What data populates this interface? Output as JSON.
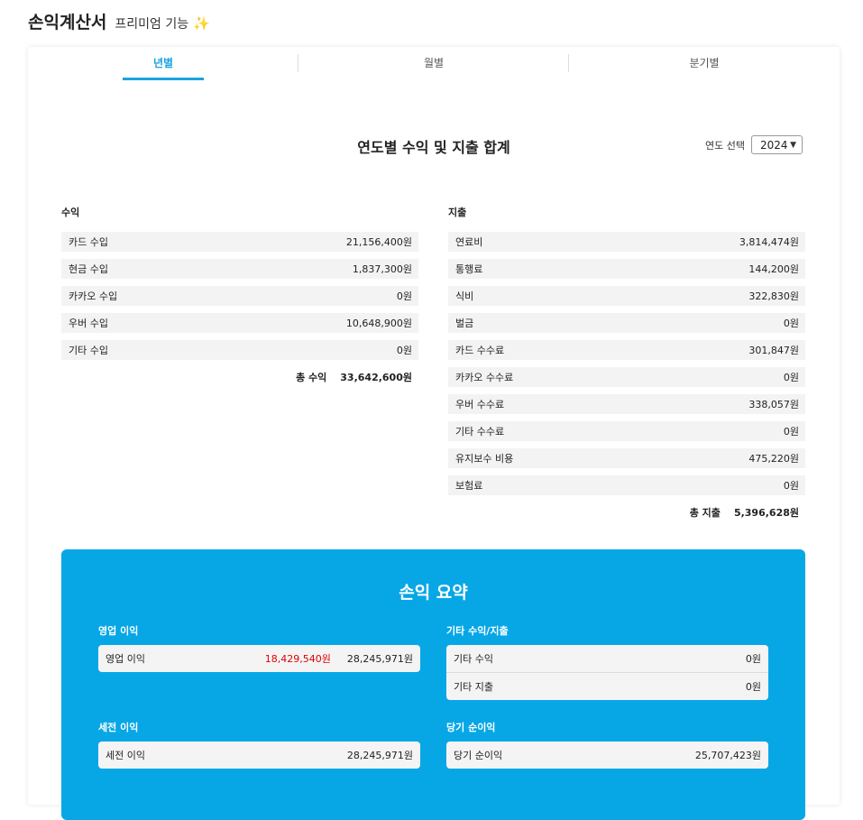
{
  "header": {
    "title": "손익계산서",
    "subtitle": "프리미엄 기능",
    "badge_icon": "sparkle-icon"
  },
  "tabs": [
    {
      "label": "년별",
      "active": true
    },
    {
      "label": "월별",
      "active": false
    },
    {
      "label": "분기별",
      "active": false
    }
  ],
  "section": {
    "title": "연도별 수익 및 지출 합계",
    "year_label": "연도 선택",
    "year_value": "2024"
  },
  "income": {
    "heading": "수익",
    "items": [
      {
        "label": "카드 수입",
        "value": "21,156,400원"
      },
      {
        "label": "현금 수입",
        "value": "1,837,300원"
      },
      {
        "label": "카카오 수입",
        "value": "0원"
      },
      {
        "label": "우버 수입",
        "value": "10,648,900원"
      },
      {
        "label": "기타 수입",
        "value": "0원"
      }
    ],
    "total_label": "총 수익",
    "total_value": "33,642,600원"
  },
  "expense": {
    "heading": "지출",
    "items": [
      {
        "label": "연료비",
        "value": "3,814,474원"
      },
      {
        "label": "통행료",
        "value": "144,200원"
      },
      {
        "label": "식비",
        "value": "322,830원"
      },
      {
        "label": "벌금",
        "value": "0원"
      },
      {
        "label": "카드 수수료",
        "value": "301,847원"
      },
      {
        "label": "카카오 수수료",
        "value": "0원"
      },
      {
        "label": "우버 수수료",
        "value": "338,057원"
      },
      {
        "label": "기타 수수료",
        "value": "0원"
      },
      {
        "label": "유지보수 비용",
        "value": "475,220원"
      },
      {
        "label": "보험료",
        "value": "0원"
      }
    ],
    "total_label": "총 지출",
    "total_value": "5,396,628원"
  },
  "summary": {
    "title": "손익 요약",
    "operating": {
      "heading": "영업 이익",
      "row_label": "영업 이익",
      "red_value": "18,429,540원",
      "value": "28,245,971원"
    },
    "other": {
      "heading": "기타 수익/지출",
      "rows": [
        {
          "label": "기타 수익",
          "value": "0원"
        },
        {
          "label": "기타 지출",
          "value": "0원"
        }
      ]
    },
    "pretax": {
      "heading": "세전 이익",
      "row_label": "세전 이익",
      "value": "28,245,971원"
    },
    "net": {
      "heading": "당기 순이익",
      "row_label": "당기 순이익",
      "value": "25,707,423원"
    }
  },
  "colors": {
    "accent": "#1aa3e0",
    "summary_bg": "#07a7e6",
    "negative": "#e00000"
  }
}
